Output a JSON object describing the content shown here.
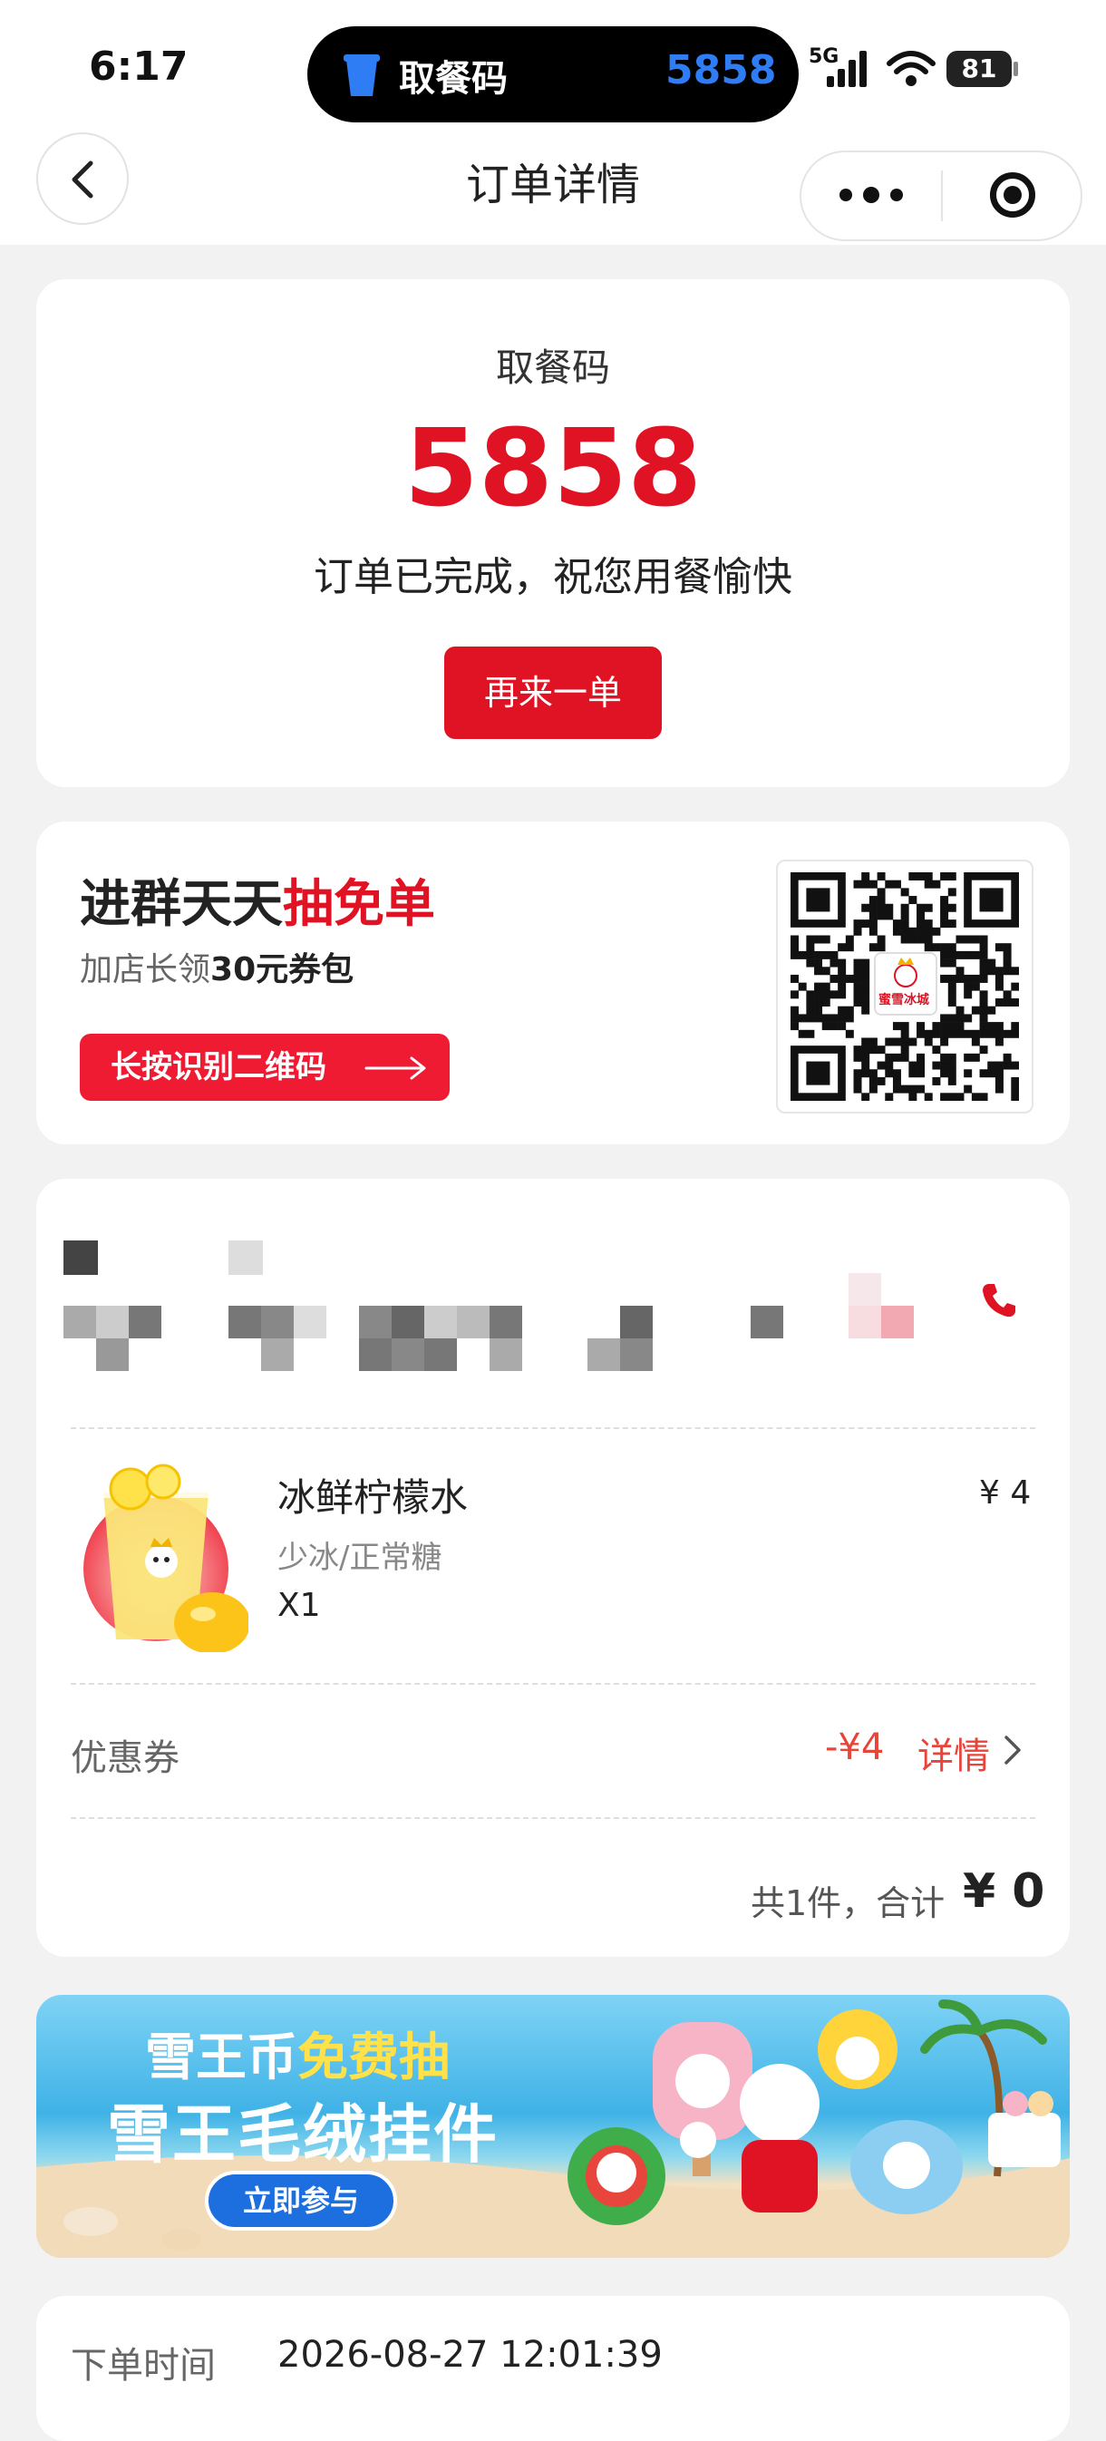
{
  "status_bar": {
    "time": "6:17",
    "island_label": "取餐码",
    "island_code": "5858",
    "network": "5G",
    "battery": "81"
  },
  "nav": {
    "title": "订单详情"
  },
  "pickup": {
    "label": "取餐码",
    "code": "5858",
    "status": "订单已完成，祝您用餐愉快",
    "reorder_label": "再来一单"
  },
  "group_promo": {
    "title_prefix": "进群天天",
    "title_highlight": "抽免单",
    "subtitle_prefix": "加店长领",
    "subtitle_bold": "30元券包",
    "button_label": "长按识别二维码",
    "qr_logo_text": "蜜雪冰城"
  },
  "order_item": {
    "name": "冰鲜柠檬水",
    "price": "¥ 4",
    "spec": "少冰/正常糖",
    "quantity": "X1"
  },
  "coupon": {
    "label": "优惠券",
    "value": "-¥4",
    "detail_label": "详情"
  },
  "total": {
    "summary": "共1件，合计",
    "amount": "¥ 0"
  },
  "banner": {
    "line1_prefix": "雪王币",
    "line1_highlight": "免费抽",
    "line2": "雪王毛绒挂件",
    "button_label": "立即参与"
  },
  "order_time": {
    "label": "下单时间",
    "value": "2026-08-27 12:01:39"
  },
  "colors": {
    "brand_red": "#e01324",
    "coupon_red": "#e8443a",
    "island_blue": "#2f7df5"
  }
}
